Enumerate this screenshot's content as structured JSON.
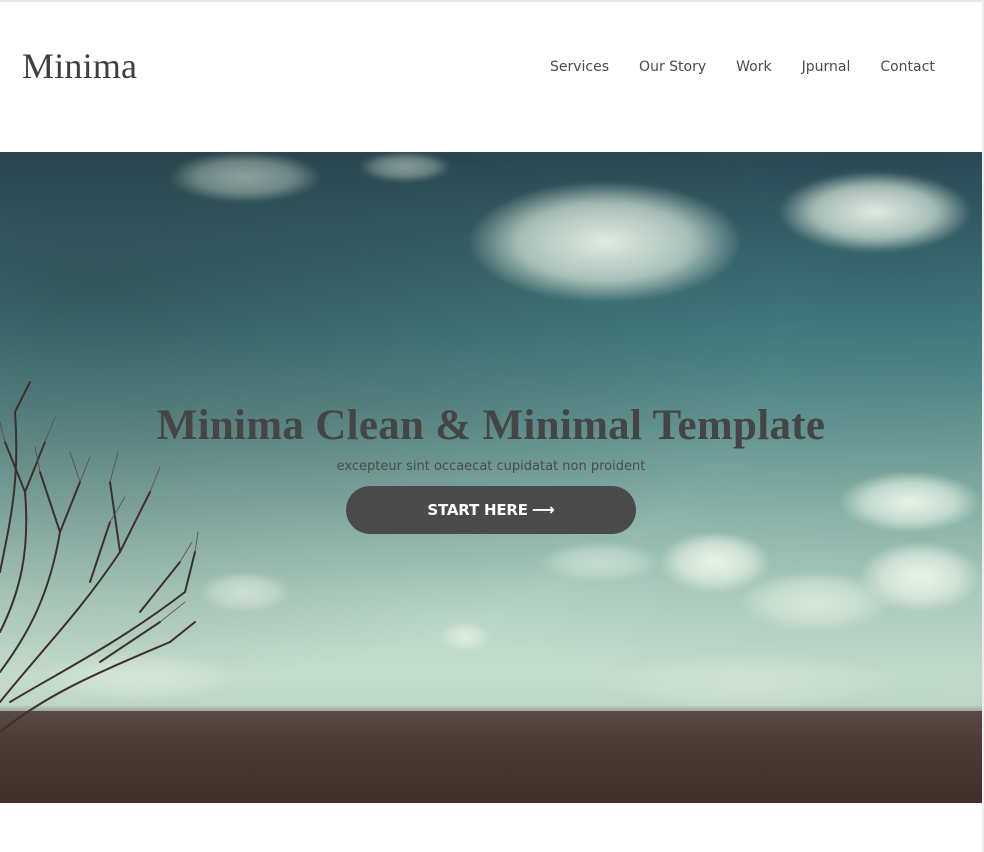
{
  "header": {
    "logo": "Minima",
    "nav": [
      {
        "label": "Services"
      },
      {
        "label": "Our Story"
      },
      {
        "label": "Work"
      },
      {
        "label": "Jpurnal"
      },
      {
        "label": "Contact"
      }
    ]
  },
  "hero": {
    "title": "Minima Clean & Minimal Template",
    "subtitle": "excepteur sint occaecat cupidatat non proident",
    "button_label": "START HERE",
    "button_icon": "arrow-right-icon"
  },
  "colors": {
    "text_dark": "#454545",
    "button_bg": "#4a4a4a",
    "button_text": "#ffffff"
  }
}
